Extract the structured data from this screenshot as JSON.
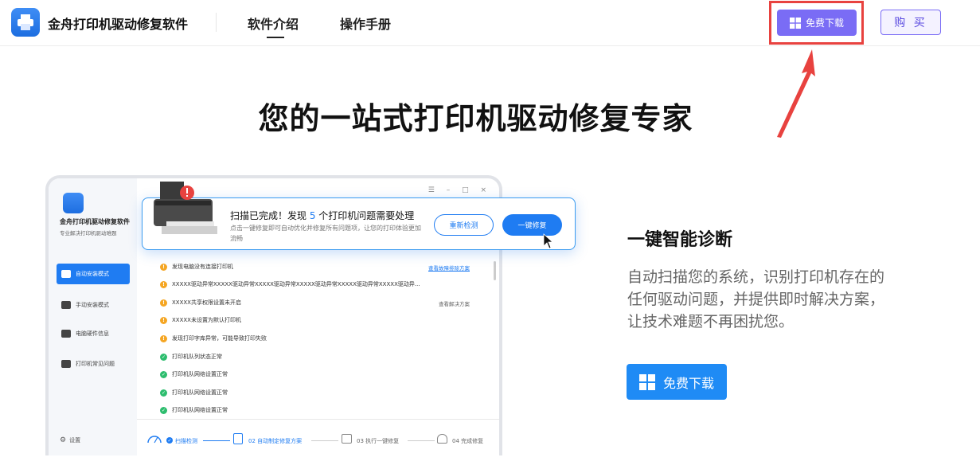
{
  "header": {
    "app_name": "金舟打印机驱动修复软件",
    "nav": [
      {
        "label": "软件介绍",
        "active": true
      },
      {
        "label": "操作手册",
        "active": false
      }
    ],
    "download_label": "免费下载",
    "buy_label": "购 买"
  },
  "hero": {
    "title": "您的一站式打印机驱动修复专家"
  },
  "mock": {
    "app_name": "金舟打印机驱动修复软件",
    "app_sub": "专业解决打印机驱动难题",
    "sidebar": [
      {
        "label": "自动安装模式",
        "active": true
      },
      {
        "label": "手动安装模式",
        "active": false
      },
      {
        "label": "电脑硬件信息",
        "active": false
      },
      {
        "label": "打印机常见问题",
        "active": false
      }
    ],
    "settings_label": "设置",
    "window_controls": "☰ – □ ×",
    "issues": [
      {
        "status": "warn",
        "text": "发现电脑没有连接打印机",
        "link": "查看故障排除方案"
      },
      {
        "status": "warn",
        "text": "XXXXX驱动异常XXXXX驱动异常XXXXX驱动异常XXXXX驱动异常XXXXX驱动异常XXXXX驱动异...",
        "link": ""
      },
      {
        "status": "warn",
        "text": "XXXXX共享权限设置未开启",
        "link": "查看解决方案"
      },
      {
        "status": "warn",
        "text": "XXXXX未设置为默认打印机",
        "link": ""
      },
      {
        "status": "warn",
        "text": "发现打印字库异常，可能导致打印失败",
        "link": ""
      },
      {
        "status": "ok",
        "text": "打印机队列状态正常",
        "link": ""
      },
      {
        "status": "ok",
        "text": "打印机队网络设置正常",
        "link": ""
      },
      {
        "status": "ok",
        "text": "打印机队网络设置正常",
        "link": ""
      },
      {
        "status": "ok",
        "text": "打印机队网络设置正常",
        "link": ""
      }
    ],
    "steps": [
      {
        "label": "扫描检测",
        "state": "done"
      },
      {
        "label": "02 自动制定修复方案",
        "state": "active"
      },
      {
        "label": "03 执行一键修复",
        "state": "todo"
      },
      {
        "label": "04 完成修复",
        "state": "todo"
      }
    ]
  },
  "popup": {
    "title_prefix": "扫描已完成！发现 ",
    "count": "5",
    "title_suffix": " 个打印机问题需要处理",
    "desc": "点击一键修复即可自动优化并修复所有问题项，让您的打印体验更加流畅",
    "rescan_label": "重新检测",
    "fix_label": "一键修复"
  },
  "feature": {
    "title": "一键智能诊断",
    "desc": "自动扫描您的系统，识别打印机存在的任何驱动问题，并提供即时解决方案，让技术难题不再困扰您。",
    "download_label": "免费下载"
  },
  "colors": {
    "brand_purple": "#7a6cf5",
    "brand_blue": "#1f7cf2",
    "highlight_red": "#e8423f"
  }
}
